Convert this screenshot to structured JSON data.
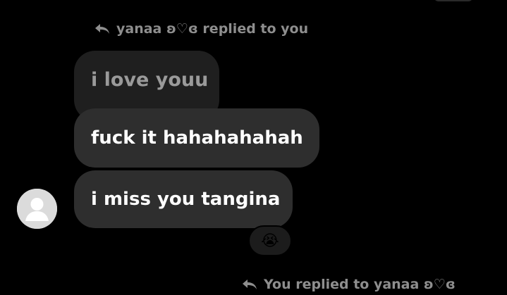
{
  "thread": {
    "reply_header": "yanaa ʚ♡ɞ replied to you",
    "quoted_message": "i love youu",
    "messages": [
      {
        "text": "fuck it hahahahahah"
      },
      {
        "text": "i miss you tangina"
      }
    ],
    "reaction_emoji": "😭",
    "bottom_reply_header": "You replied to yanaa ʚ♡ɞ"
  },
  "colors": {
    "background": "#000000",
    "bubble": "#2e2e2e",
    "quoted_bubble": "#1f1f1f",
    "meta_text": "#8e8e8e"
  },
  "icons": {
    "reply": "reply-arrow-icon",
    "avatar": "default-avatar-icon"
  }
}
